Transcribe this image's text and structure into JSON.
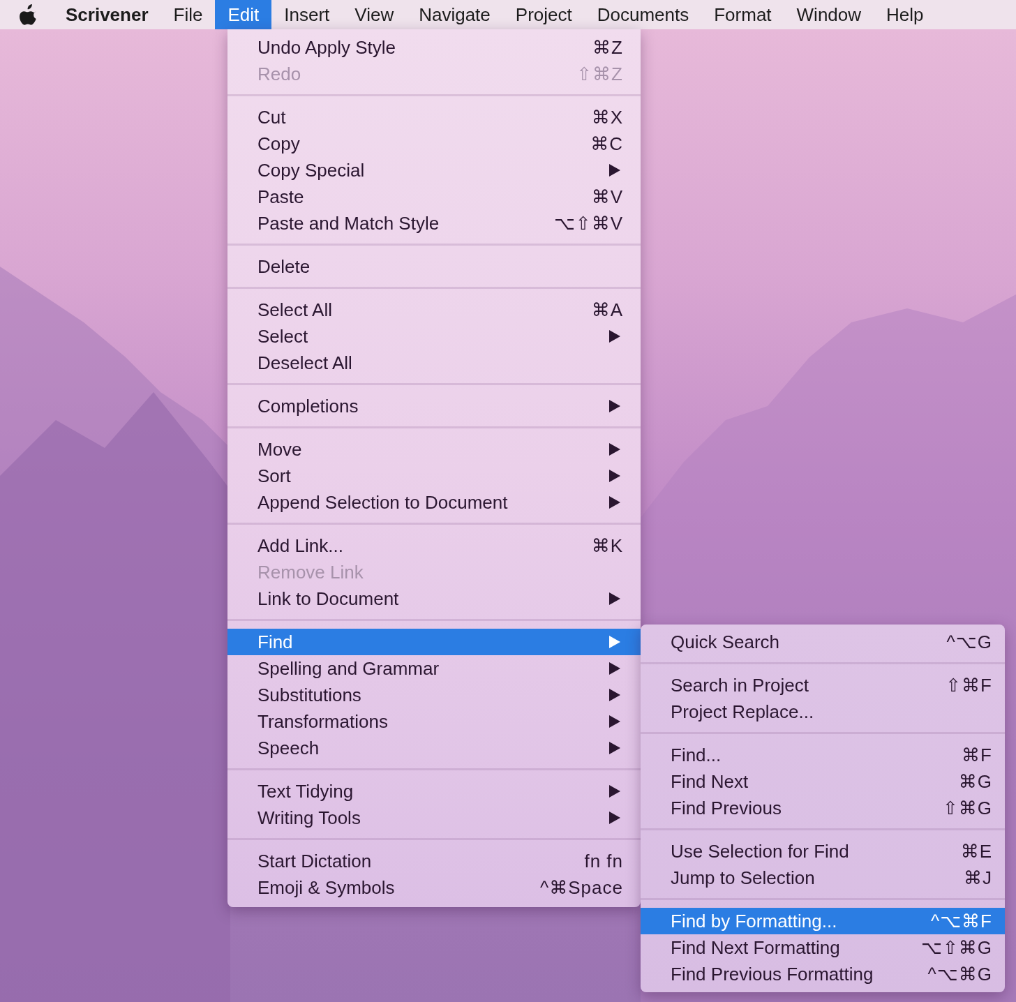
{
  "menu_bar": {
    "app_name": "Scrivener",
    "items": [
      {
        "label": "File",
        "selected": false
      },
      {
        "label": "Edit",
        "selected": true
      },
      {
        "label": "Insert",
        "selected": false
      },
      {
        "label": "View",
        "selected": false
      },
      {
        "label": "Navigate",
        "selected": false
      },
      {
        "label": "Project",
        "selected": false
      },
      {
        "label": "Documents",
        "selected": false
      },
      {
        "label": "Format",
        "selected": false
      },
      {
        "label": "Window",
        "selected": false
      },
      {
        "label": "Help",
        "selected": false
      }
    ]
  },
  "edit_menu": {
    "groups": [
      [
        {
          "label": "Undo Apply Style",
          "shortcut": "⌘Z",
          "submenu": false,
          "disabled": false,
          "selected": false
        },
        {
          "label": "Redo",
          "shortcut": "⇧⌘Z",
          "submenu": false,
          "disabled": true,
          "selected": false
        }
      ],
      [
        {
          "label": "Cut",
          "shortcut": "⌘X",
          "submenu": false,
          "disabled": false,
          "selected": false
        },
        {
          "label": "Copy",
          "shortcut": "⌘C",
          "submenu": false,
          "disabled": false,
          "selected": false
        },
        {
          "label": "Copy Special",
          "submenu": true,
          "disabled": false,
          "selected": false
        },
        {
          "label": "Paste",
          "shortcut": "⌘V",
          "submenu": false,
          "disabled": false,
          "selected": false
        },
        {
          "label": "Paste and Match Style",
          "shortcut": "⌥⇧⌘V",
          "submenu": false,
          "disabled": false,
          "selected": false
        }
      ],
      [
        {
          "label": "Delete",
          "submenu": false,
          "disabled": false,
          "selected": false
        }
      ],
      [
        {
          "label": "Select All",
          "shortcut": "⌘A",
          "submenu": false,
          "disabled": false,
          "selected": false
        },
        {
          "label": "Select",
          "submenu": true,
          "disabled": false,
          "selected": false
        },
        {
          "label": "Deselect All",
          "submenu": false,
          "disabled": false,
          "selected": false
        }
      ],
      [
        {
          "label": "Completions",
          "submenu": true,
          "disabled": false,
          "selected": false
        }
      ],
      [
        {
          "label": "Move",
          "submenu": true,
          "disabled": false,
          "selected": false
        },
        {
          "label": "Sort",
          "submenu": true,
          "disabled": false,
          "selected": false
        },
        {
          "label": "Append Selection to Document",
          "submenu": true,
          "disabled": false,
          "selected": false
        }
      ],
      [
        {
          "label": "Add Link...",
          "shortcut": "⌘K",
          "submenu": false,
          "disabled": false,
          "selected": false
        },
        {
          "label": "Remove Link",
          "submenu": false,
          "disabled": true,
          "selected": false
        },
        {
          "label": "Link to Document",
          "submenu": true,
          "disabled": false,
          "selected": false
        }
      ],
      [
        {
          "label": "Find",
          "submenu": true,
          "disabled": false,
          "selected": true
        },
        {
          "label": "Spelling and Grammar",
          "submenu": true,
          "disabled": false,
          "selected": false
        },
        {
          "label": "Substitutions",
          "submenu": true,
          "disabled": false,
          "selected": false
        },
        {
          "label": "Transformations",
          "submenu": true,
          "disabled": false,
          "selected": false
        },
        {
          "label": "Speech",
          "submenu": true,
          "disabled": false,
          "selected": false
        }
      ],
      [
        {
          "label": "Text Tidying",
          "submenu": true,
          "disabled": false,
          "selected": false
        },
        {
          "label": "Writing Tools",
          "submenu": true,
          "disabled": false,
          "selected": false
        }
      ],
      [
        {
          "label": "Start Dictation",
          "shortcut": "fn fn",
          "submenu": false,
          "disabled": false,
          "selected": false
        },
        {
          "label": "Emoji & Symbols",
          "shortcut": "^⌘Space",
          "submenu": false,
          "disabled": false,
          "selected": false
        }
      ]
    ]
  },
  "find_submenu": {
    "groups": [
      [
        {
          "label": "Quick Search",
          "shortcut": "^⌥G",
          "selected": false
        }
      ],
      [
        {
          "label": "Search in Project",
          "shortcut": "⇧⌘F",
          "selected": false
        },
        {
          "label": "Project Replace...",
          "selected": false
        }
      ],
      [
        {
          "label": "Find...",
          "shortcut": "⌘F",
          "selected": false
        },
        {
          "label": "Find Next",
          "shortcut": "⌘G",
          "selected": false
        },
        {
          "label": "Find Previous",
          "shortcut": "⇧⌘G",
          "selected": false
        }
      ],
      [
        {
          "label": "Use Selection for Find",
          "shortcut": "⌘E",
          "selected": false
        },
        {
          "label": "Jump to Selection",
          "shortcut": "⌘J",
          "selected": false
        }
      ],
      [
        {
          "label": "Find by Formatting...",
          "shortcut": "^⌥⌘F",
          "selected": true
        },
        {
          "label": "Find Next Formatting",
          "shortcut": "⌥⇧⌘G",
          "selected": false
        },
        {
          "label": "Find Previous Formatting",
          "shortcut": "^⌥⌘G",
          "selected": false
        }
      ]
    ]
  }
}
